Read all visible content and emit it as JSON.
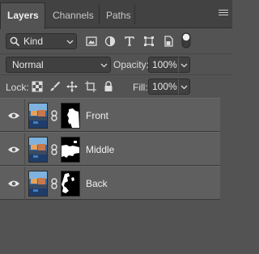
{
  "tabs": [
    {
      "label": "Layers",
      "active": true
    },
    {
      "label": "Channels",
      "active": false
    },
    {
      "label": "Paths",
      "active": false
    }
  ],
  "filter": {
    "kind_label": "Kind",
    "icons": [
      "image-filter-icon",
      "adjustment-filter-icon",
      "type-filter-icon",
      "shape-filter-icon",
      "smart-object-filter-icon",
      "filter-toggle-icon"
    ]
  },
  "blend": {
    "mode": "Normal",
    "opacity_label": "Opacity:",
    "opacity_value": "100%"
  },
  "lock": {
    "label": "Lock:",
    "icons": [
      "lock-transparent-pixels-icon",
      "lock-image-pixels-icon",
      "lock-position-icon",
      "lock-artboard-icon",
      "lock-all-icon"
    ],
    "fill_label": "Fill:",
    "fill_value": "100%"
  },
  "layers": [
    {
      "name": "Front",
      "visible": true
    },
    {
      "name": "Middle",
      "visible": true
    },
    {
      "name": "Back",
      "visible": true
    }
  ],
  "colors": {
    "panel_bg": "#535353",
    "tabbar_bg": "#424242",
    "layer_row_bg": "#5f5f5f",
    "text": "#e6e6e6"
  }
}
